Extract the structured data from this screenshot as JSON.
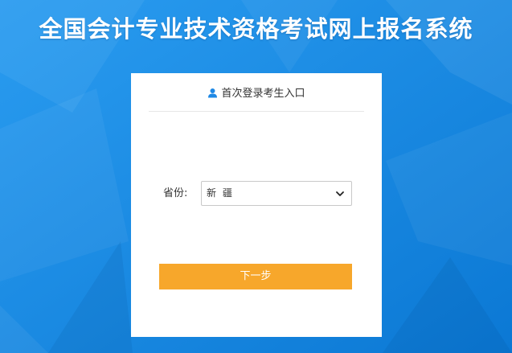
{
  "header": {
    "site_title": "全国会计专业技术资格考试网上报名系统"
  },
  "login_panel": {
    "title": "首次登录考生入口",
    "title_icon": "user-icon",
    "province_label": "省份:",
    "province_value": "新 疆",
    "dropdown_icon": "chevron-down-icon",
    "next_button_label": "下一步"
  },
  "colors": {
    "background": "#1a8fe3",
    "button": "#f7a72b",
    "panel": "#ffffff",
    "icon": "#1e88e5"
  }
}
